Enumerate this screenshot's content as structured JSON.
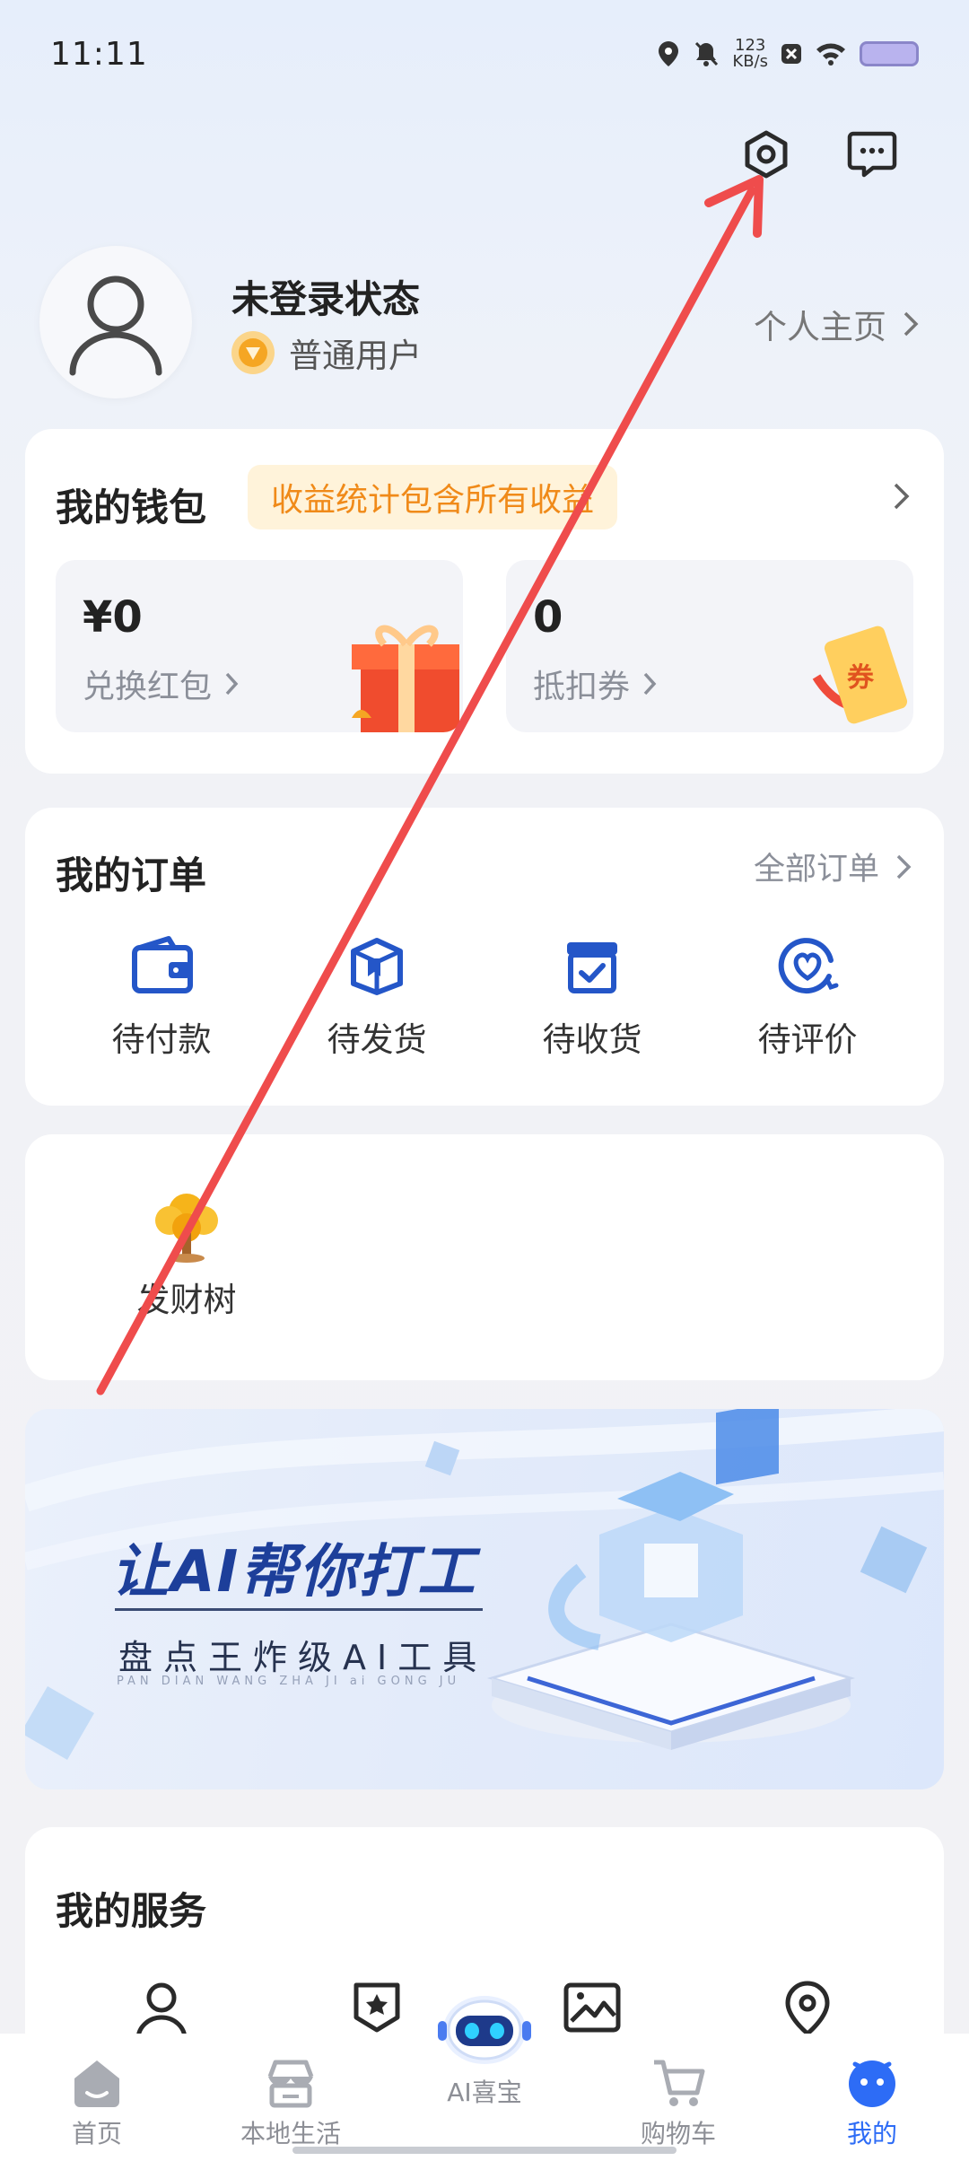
{
  "status": {
    "time": "11:11",
    "speed_value": "123",
    "speed_unit": "KB/s"
  },
  "top_icons": [
    "settings-icon",
    "message-icon"
  ],
  "profile": {
    "name": "未登录状态",
    "user_type": "普通用户",
    "homepage_link": "个人主页"
  },
  "wallet": {
    "title": "我的钱包",
    "badge": "收益统计包含所有收益",
    "items": [
      {
        "value": "¥0",
        "label": "兑换红包"
      },
      {
        "value": "0",
        "label": "抵扣券"
      }
    ],
    "coupon_char": "券"
  },
  "orders": {
    "title": "我的订单",
    "all_link": "全部订单",
    "items": [
      {
        "label": "待付款",
        "icon": "wallet-icon"
      },
      {
        "label": "待发货",
        "icon": "package-icon"
      },
      {
        "label": "待收货",
        "icon": "box-check-icon"
      },
      {
        "label": "待评价",
        "icon": "heart-review-icon"
      }
    ]
  },
  "tree": {
    "label": "发财树"
  },
  "banner": {
    "title": "让AI帮你打工",
    "subtitle": "盘点王炸级AI工具",
    "small": "PAN DIAN WANG ZHA JI ai GONG JU"
  },
  "services": {
    "title": "我的服务",
    "icons": [
      "person-icon",
      "badge-icon",
      "picture-icon",
      "location-icon"
    ]
  },
  "nav": [
    {
      "label": "首页"
    },
    {
      "label": "本地生活"
    },
    {
      "label": "AI喜宝"
    },
    {
      "label": "购物车"
    },
    {
      "label": "我的"
    }
  ],
  "colors": {
    "accent": "#2d6cf6",
    "annotation_arrow": "#ef4c4c",
    "badge_text": "#f08a19",
    "banner_title": "#1d3f9a"
  }
}
